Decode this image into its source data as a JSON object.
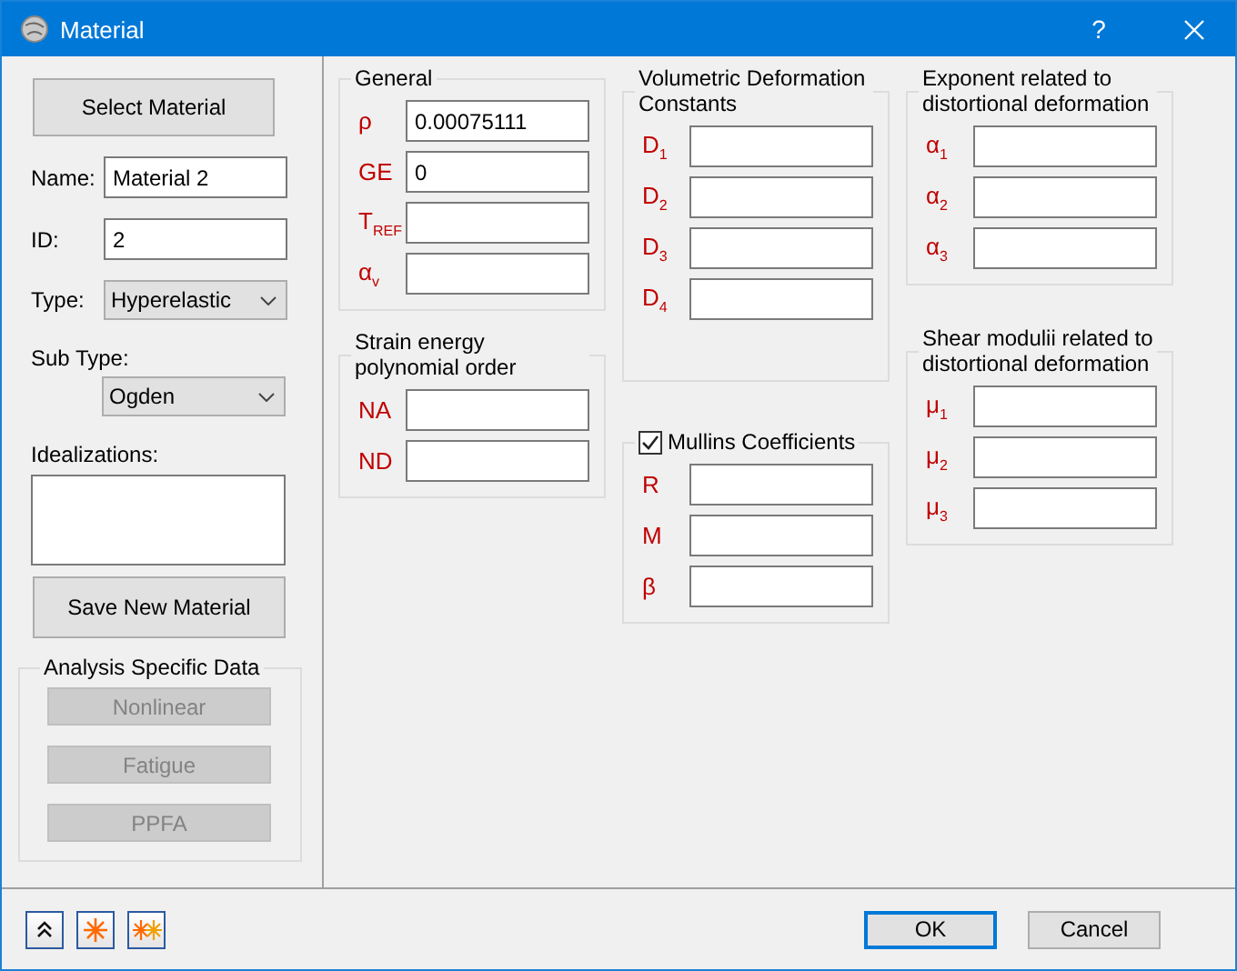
{
  "window": {
    "title": "Material",
    "help": "?"
  },
  "left": {
    "select_button": "Select Material",
    "name": {
      "label": "Name:",
      "value": "Material 2"
    },
    "id": {
      "label": "ID:",
      "value": "2"
    },
    "type": {
      "label": "Type:",
      "value": "Hyperelastic"
    },
    "sub_type": {
      "label": "Sub Type:",
      "value": "Ogden"
    },
    "idealizations": {
      "label": "Idealizations:"
    },
    "save_button": "Save New Material",
    "analysis": {
      "title": "Analysis Specific Data",
      "buttons": [
        {
          "label": "Nonlinear",
          "disabled": true
        },
        {
          "label": "Fatigue",
          "disabled": true
        },
        {
          "label": "PPFA",
          "disabled": true
        }
      ]
    }
  },
  "columns": [
    [
      {
        "kind": "plain",
        "title": "General",
        "fields": [
          {
            "label": "ρ",
            "value": "0.00075111"
          },
          {
            "label": "GE",
            "value": "0"
          },
          {
            "label": "T$_{REF}$"
          },
          {
            "label": "α$_{v}$"
          }
        ]
      },
      {
        "kind": "plain",
        "title": "Strain energy polynomial order",
        "fields": [
          {
            "label": "NA"
          },
          {
            "label": "ND"
          }
        ]
      }
    ],
    [
      {
        "kind": "plain",
        "title": "Volumetric Deformation Constants",
        "fields": [
          {
            "label": "D$_{1}$"
          },
          {
            "label": "D$_{2}$"
          },
          {
            "label": "D$_{3}$"
          },
          {
            "label": "D$_{4}$"
          }
        ]
      },
      {
        "kind": "checkbox",
        "checked": true,
        "title": "Mullins Coefficients",
        "fields": [
          {
            "label": "R"
          },
          {
            "label": "M"
          },
          {
            "label": "β"
          }
        ]
      }
    ],
    [
      {
        "kind": "plain",
        "title": "Exponent related to distortional deformation",
        "fields": [
          {
            "label": "α$_{1}$"
          },
          {
            "label": "α$_{2}$"
          },
          {
            "label": "α$_{3}$"
          }
        ]
      },
      {
        "kind": "plain",
        "title": "Shear modulii related to distortional deformation",
        "fields": [
          {
            "label": "μ$_{1}$"
          },
          {
            "label": "μ$_{2}$"
          },
          {
            "label": "μ$_{3}$"
          }
        ]
      }
    ]
  ],
  "footer": {
    "buttons": [
      {
        "label": "OK",
        "default": true
      },
      {
        "label": "Cancel",
        "default": false
      }
    ]
  }
}
